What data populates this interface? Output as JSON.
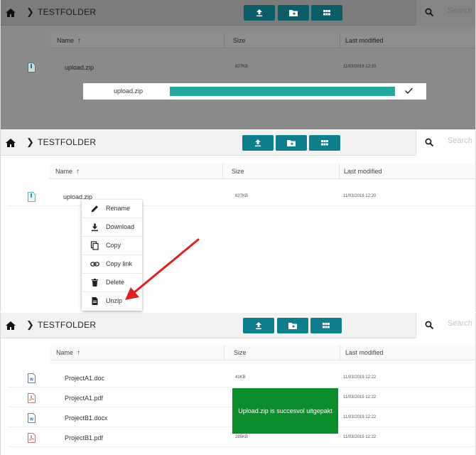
{
  "toolbar": {
    "folder": "TESTFOLDER",
    "search_placeholder": "Search"
  },
  "table": {
    "columns": [
      "Name",
      "Size",
      "Last modified"
    ]
  },
  "panel1": {
    "rows": [
      {
        "name": "upload.zip",
        "size": "827KB",
        "modified": "11/03/2019 12:20",
        "type": "zip"
      }
    ],
    "upload": {
      "filename": "upload.zip",
      "progress": 1.0
    }
  },
  "panel2": {
    "rows": [
      {
        "name": "upload.zip",
        "size": "827KB",
        "modified": "11/03/2019 12:20",
        "type": "zip"
      }
    ],
    "context_menu": [
      {
        "label": "Rename",
        "icon": "pencil-icon"
      },
      {
        "label": "Download",
        "icon": "download-icon"
      },
      {
        "label": "Copy",
        "icon": "copy-icon"
      },
      {
        "label": "Copy link",
        "icon": "link-icon"
      },
      {
        "label": "Delete",
        "icon": "trash-icon"
      },
      {
        "label": "Unzip",
        "icon": "file-icon"
      }
    ]
  },
  "panel3": {
    "rows": [
      {
        "name": "ProjectA1.doc",
        "size": "41KB",
        "modified": "11/03/2019 12:22",
        "type": "word"
      },
      {
        "name": "ProjectA1.pdf",
        "size": "",
        "modified": "11/03/2019 12:22",
        "type": "pdf"
      },
      {
        "name": "ProjectB1.docx",
        "size": "",
        "modified": "11/03/2019 12:22",
        "type": "word"
      },
      {
        "name": "ProjectB1.pdf",
        "size": "285KB",
        "modified": "11/03/2019 12:22",
        "type": "pdf"
      }
    ],
    "toast": "Upload.zip is succesvol uitgepakt"
  },
  "colors": {
    "accent": "#0e7d8c",
    "progress": "#23a99c",
    "toast": "#0a8d2a",
    "annotation_arrow": "#e0201a"
  }
}
